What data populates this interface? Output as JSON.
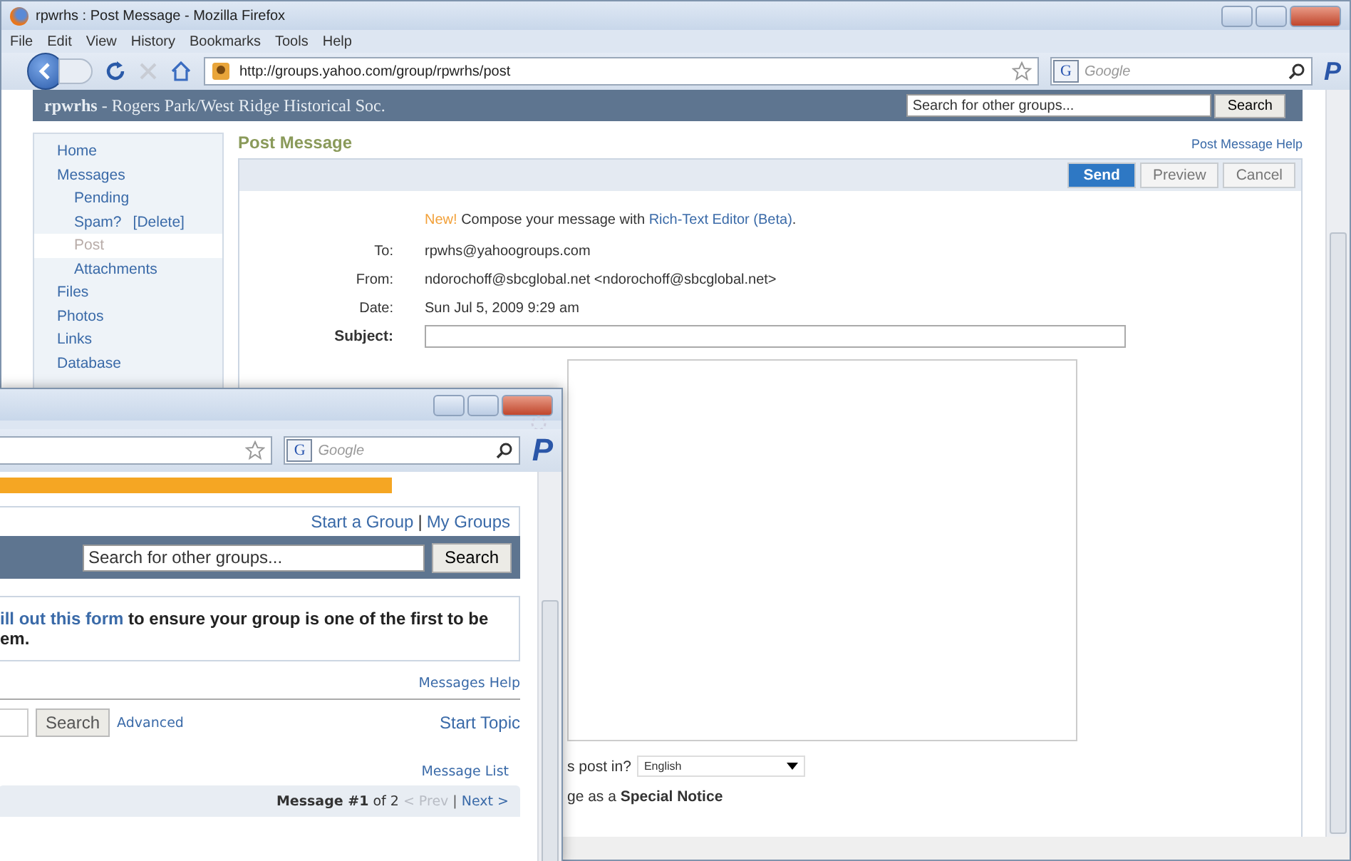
{
  "back_window": {
    "title": "rpwrhs : Post Message - Mozilla Firefox",
    "menu": [
      "File",
      "Edit",
      "View",
      "History",
      "Bookmarks",
      "Tools",
      "Help"
    ],
    "url": "http://groups.yahoo.com/group/rpwrhs/post",
    "search_engine_logo": "G",
    "search_engine_placeholder": "Google",
    "addon_logo": "P",
    "group_header": {
      "name": "rpwrhs",
      "subtitle": " - Rogers Park/West Ridge Historical Soc.",
      "search_placeholder": "Search for other groups...",
      "search_button": "Search"
    },
    "sidebar": {
      "items": [
        {
          "label": "Home",
          "selected": false
        },
        {
          "label": "Messages",
          "selected": false,
          "children": [
            {
              "label": "Pending",
              "selected": false
            },
            {
              "label": "Spam?",
              "action": "[Delete]",
              "selected": false
            },
            {
              "label": "Post",
              "selected": true
            },
            {
              "label": "Attachments",
              "selected": false
            }
          ]
        },
        {
          "label": "Files",
          "selected": false
        },
        {
          "label": "Photos",
          "selected": false
        },
        {
          "label": "Links",
          "selected": false
        },
        {
          "label": "Database",
          "selected": false
        }
      ]
    },
    "page_title": "Post Message",
    "help_link": "Post Message Help",
    "buttons": [
      {
        "label": "Send",
        "kind": "primary"
      },
      {
        "label": "Preview",
        "kind": "plain"
      },
      {
        "label": "Cancel",
        "kind": "plain"
      }
    ],
    "announcement": {
      "badge": "New!",
      "text": " Compose your message with ",
      "link": "Rich-Text Editor (Beta)",
      "end": "."
    },
    "fields": [
      {
        "label": "To:",
        "value": "rpwhs@yahoogroups.com",
        "kind": "text"
      },
      {
        "label": "From:",
        "value": "ndorochoff@sbcglobal.net <ndorochoff@sbcglobal.net>",
        "kind": "text"
      },
      {
        "label": "Date:",
        "value": "Sun Jul 5, 2009 9:29 am",
        "kind": "text"
      },
      {
        "label": "Subject:",
        "kind": "input"
      }
    ],
    "language_label": "s post in?",
    "language_value": "English",
    "special_notice": "ge as a **Special Notice**"
  },
  "front_window": {
    "search_engine_logo": "G",
    "search_engine_placeholder": "Google",
    "addon_logo": "P",
    "top_links": {
      "start": "Start a Group",
      "sep": "|",
      "mine": "My Groups"
    },
    "search_placeholder": "Search for other groups...",
    "search_button": "Search",
    "notice": {
      "link": "ill out this form",
      "text": " to ensure your group is one of the first to be",
      "line2": "em."
    },
    "messages_help": "Messages Help",
    "message_search_button": "Search",
    "advanced_link": "Advanced",
    "start_topic": "Start Topic",
    "message_list": "Message List",
    "pager": {
      "text": "**Message #1** of 2",
      "prev": "< Prev",
      "sep": "|",
      "next": "Next >"
    }
  }
}
